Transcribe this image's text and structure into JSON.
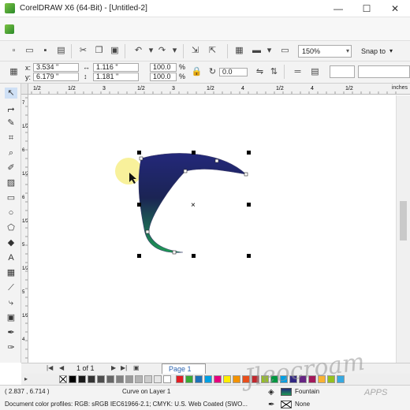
{
  "window": {
    "title": "CorelDRAW X6 (64-Bit) - [Untitled-2]",
    "minimize": "—",
    "maximize": "☐",
    "close": "✕"
  },
  "toolbar": {
    "zoom": "150%",
    "snap_to": "Snap to"
  },
  "propbar": {
    "x_label": "x:",
    "x_value": "3.534 \"",
    "y_label": "y:",
    "y_value": "6.179 \"",
    "width_value": "1.116 \"",
    "height_value": "1.181 \"",
    "scale_x": "100.0",
    "scale_y": "100.0",
    "percent": "%",
    "rotation": "0.0"
  },
  "rulers": {
    "units": "inches",
    "h_labels": [
      "1/2",
      "1/2",
      "3",
      "1/2",
      "3",
      "1/2",
      "4",
      "1/2",
      "4",
      "1/2"
    ],
    "v_labels": [
      "7",
      "1/2",
      "6",
      "1/2",
      "6",
      "1/2",
      "5",
      "1/2",
      "5",
      "1/2",
      "4"
    ]
  },
  "pagebar": {
    "page_count": "1 of 1",
    "page_tab": "Page 1"
  },
  "status": {
    "coordinates": "( 2.837 , 6.714 )",
    "selection": "Curve on Layer 1",
    "color_profiles": "Document color profiles: RGB: sRGB IEC61966-2.1; CMYK: U.S. Web Coated (SWO...",
    "fill_label": "Fountain",
    "outline_label": "None"
  },
  "watermark": {
    "text": "Jleocroam",
    "apps": "APPS"
  },
  "colors": {
    "fill_top": "#23287a",
    "fill_bottom": "#1f9a55",
    "highlight": "#f5ec7a"
  }
}
